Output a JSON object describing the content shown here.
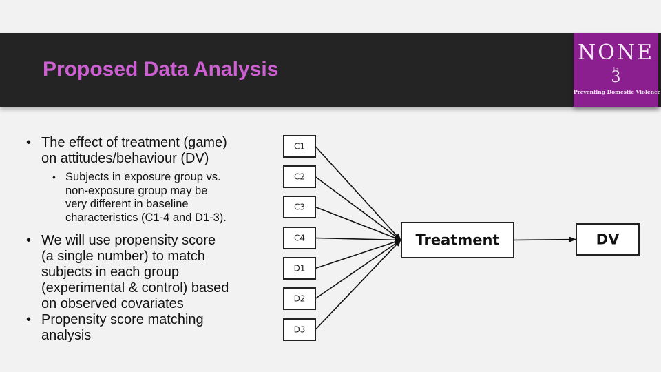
{
  "header": {
    "title": "Proposed Data Analysis",
    "title_color": "#cd5fd3",
    "band_color": "#242424"
  },
  "logo": {
    "word": "NONE",
    "in": "in",
    "number": "3",
    "tagline": "Preventing Domestic Violence",
    "background": "#8b1f8f"
  },
  "bullets": [
    {
      "level": 1,
      "lines": [
        "The effect of treatment (game)",
        "on attitudes/behaviour (DV)"
      ]
    },
    {
      "level": 2,
      "lines": [
        "Subjects in exposure group vs.",
        "non-exposure group may be",
        "very different in baseline",
        "characteristics (C1-4 and D1-3)."
      ]
    },
    {
      "level": 1,
      "lines": [
        "We will use propensity score",
        "(a single number) to match",
        "subjects in each group",
        "(experimental & control) based",
        "on observed covariates"
      ]
    },
    {
      "level": 1,
      "lines": [
        "Propensity score matching",
        "analysis"
      ]
    }
  ],
  "bullet_glyph": "•",
  "diagram": {
    "covariates": [
      "C1",
      "C2",
      "C3",
      "C4",
      "D1",
      "D2",
      "D3"
    ],
    "treatment": "Treatment",
    "outcome": "DV",
    "edges": [
      [
        "C1",
        "Treatment"
      ],
      [
        "C2",
        "Treatment"
      ],
      [
        "C3",
        "Treatment"
      ],
      [
        "C4",
        "Treatment"
      ],
      [
        "D1",
        "Treatment"
      ],
      [
        "D2",
        "Treatment"
      ],
      [
        "D3",
        "Treatment"
      ],
      [
        "Treatment",
        "DV"
      ]
    ]
  }
}
